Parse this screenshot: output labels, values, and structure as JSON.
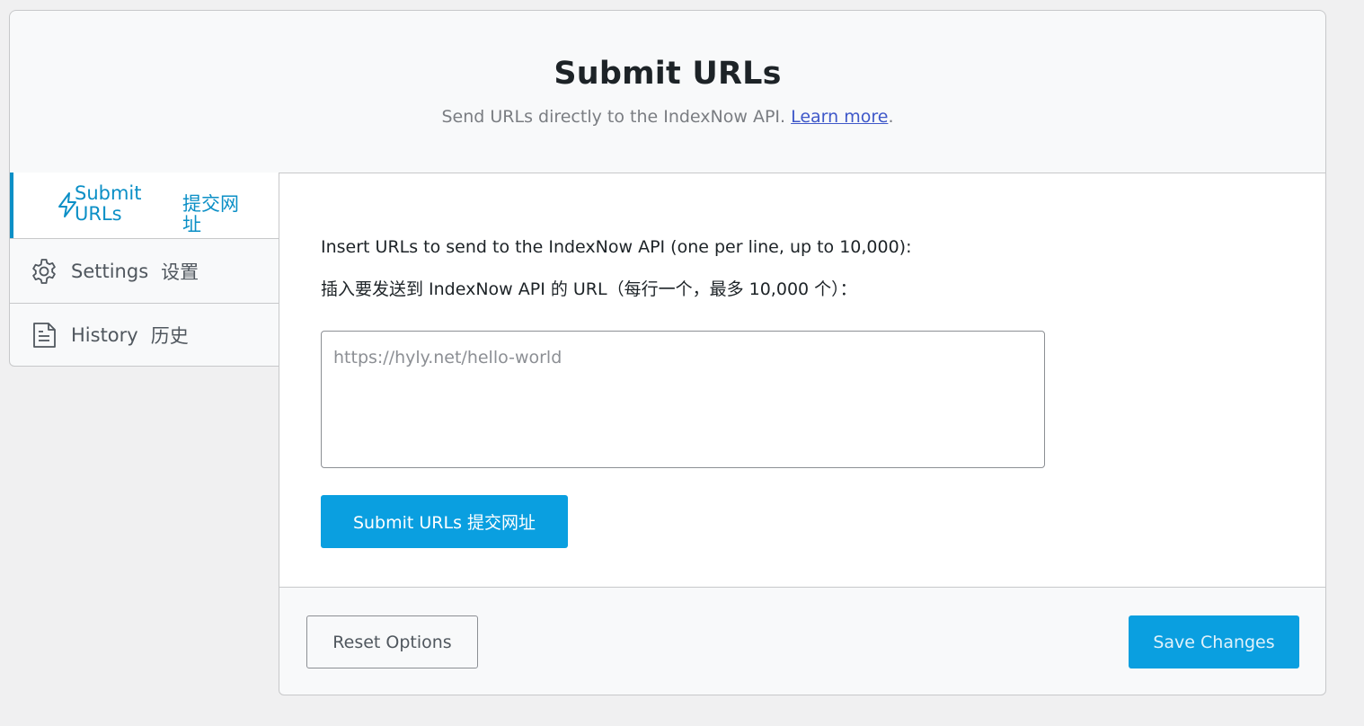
{
  "header": {
    "title": "Submit URLs",
    "subtitle": "Send URLs directly to the IndexNow API.",
    "learn_more": "Learn more",
    "period": "."
  },
  "sidebar": {
    "items": [
      {
        "label_en": "Submit URLs",
        "label_zh": "提交网址",
        "icon": "lightning-icon",
        "active": true
      },
      {
        "label_en": "Settings",
        "label_zh": "设置",
        "icon": "gear-icon",
        "active": false
      },
      {
        "label_en": "History",
        "label_zh": "历史",
        "icon": "document-icon",
        "active": false
      }
    ]
  },
  "main": {
    "instruction_en": "Insert URLs to send to the IndexNow API (one per line, up to 10,000):",
    "instruction_zh": "插入要发送到 IndexNow API 的 URL（每行一个，最多 10,000 个）：",
    "textarea_placeholder": "https://hyly.net/hello-world",
    "textarea_value": "",
    "submit_label": "Submit URLs  提交网址"
  },
  "footer": {
    "reset_label": "Reset Options",
    "save_label": "Save Changes"
  },
  "colors": {
    "accent": "#0a9fe0",
    "link": "#3f58c9",
    "active_nav": "#0b8fc6"
  }
}
